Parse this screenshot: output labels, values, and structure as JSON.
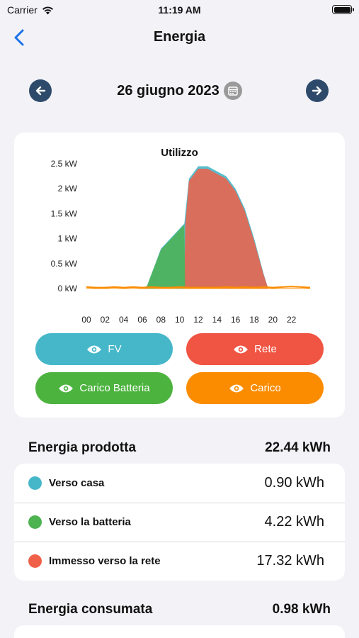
{
  "status": {
    "carrier": "Carrier",
    "time": "11:19 AM"
  },
  "nav": {
    "title": "Energia"
  },
  "date": {
    "label": "26 giugno 2023"
  },
  "chart_data": {
    "type": "area",
    "title": "Utilizzo",
    "x_ticks": [
      "00",
      "02",
      "04",
      "06",
      "08",
      "10",
      "12",
      "14",
      "16",
      "18",
      "20",
      "22"
    ],
    "y_ticks": [
      "2.5 kW",
      "2 kW",
      "1.5 kW",
      "1 kW",
      "0.5 kW",
      "0 kW"
    ],
    "ylim": [
      -0.3,
      2.5
    ],
    "xlim": [
      0,
      24
    ],
    "colors": {
      "FV": "#45b7c9",
      "Rete": "#f06048",
      "Carico Batteria": "#4cb350",
      "Carico": "#fb8c00"
    },
    "series": [
      {
        "name": "FV",
        "x": [
          0,
          5.8,
          6.5,
          7,
          8,
          9,
          10,
          10.5,
          11,
          12,
          13,
          14,
          15,
          16,
          17,
          18,
          19,
          19.5,
          20,
          24
        ],
        "y": [
          0,
          0,
          0.05,
          0.3,
          0.8,
          1.0,
          1.2,
          1.3,
          2.2,
          2.45,
          2.45,
          2.35,
          2.25,
          2.0,
          1.6,
          1.0,
          0.3,
          0,
          0,
          0
        ]
      },
      {
        "name": "Carico Batteria",
        "x": [
          0,
          5.8,
          6.5,
          7,
          8,
          9,
          10,
          10.5,
          10.6,
          24
        ],
        "y": [
          0,
          0,
          0.05,
          0.3,
          0.78,
          0.98,
          1.18,
          1.28,
          0,
          0
        ]
      },
      {
        "name": "Rete",
        "x": [
          0,
          10.5,
          10.6,
          11,
          12,
          13,
          14,
          15,
          16,
          17,
          18,
          19,
          19.5,
          20,
          24
        ],
        "y": [
          0,
          0,
          1.28,
          2.15,
          2.4,
          2.4,
          2.3,
          2.2,
          1.95,
          1.55,
          0.95,
          0.28,
          0,
          0,
          0
        ]
      },
      {
        "name": "Carico",
        "x": [
          0,
          1,
          2,
          3,
          4,
          5,
          6,
          7,
          8,
          9,
          10,
          11,
          12,
          13,
          14,
          15,
          16,
          17,
          18,
          19,
          20,
          21,
          22,
          23,
          24
        ],
        "y": [
          0.03,
          0.02,
          0.02,
          0.03,
          0.02,
          0.03,
          0.02,
          0.03,
          0.02,
          0.02,
          0.03,
          0.02,
          0.02,
          0.02,
          0.02,
          0.03,
          0.02,
          0.03,
          0.02,
          0.03,
          0.02,
          0.03,
          0.04,
          0.03,
          0.02
        ]
      }
    ]
  },
  "legend": {
    "fv": "FV",
    "rete": "Rete",
    "carico_batteria": "Carico Batteria",
    "carico": "Carico"
  },
  "produced": {
    "title": "Energia prodotta",
    "total": "22.44 kWh",
    "rows": [
      {
        "label": "Verso casa",
        "value": "0.90 kWh",
        "color": "#45b7c9"
      },
      {
        "label": "Verso la batteria",
        "value": "4.22 kWh",
        "color": "#4cb350"
      },
      {
        "label": "Immesso verso la rete",
        "value": "17.32 kWh",
        "color": "#f06048"
      }
    ]
  },
  "consumed": {
    "title": "Energia consumata",
    "total": "0.98 kWh"
  }
}
